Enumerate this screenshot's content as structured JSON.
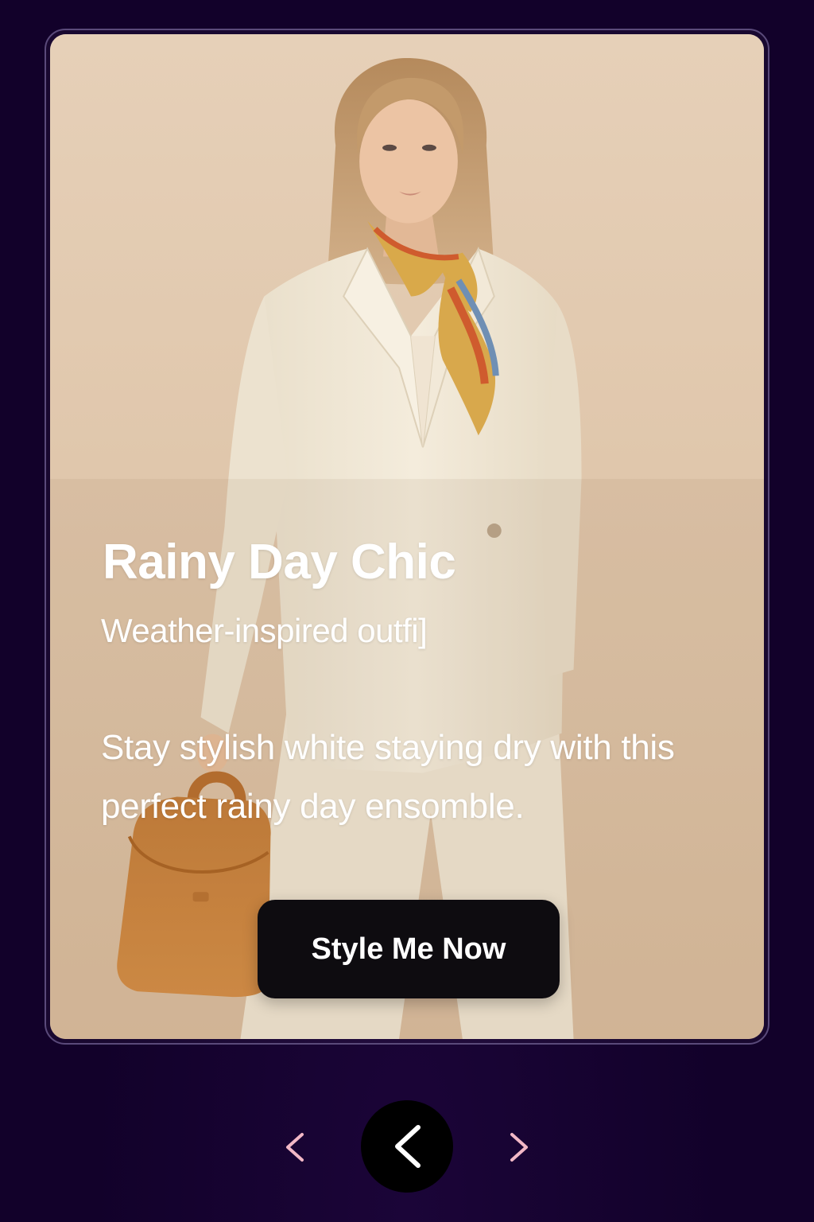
{
  "card": {
    "title": "Rainy Day Chic",
    "subtitle": "Weather-inspired outfi]",
    "description": "Stay stylish white staying dry with this perfect rainy day ensomble.",
    "cta_label": "Style Me Now",
    "image_icon": "fashion-model-photo"
  },
  "navigation": {
    "prev_icon": "chevron-left-icon",
    "main_icon": "chevron-left-icon",
    "next_icon": "chevron-right-icon"
  },
  "colors": {
    "background": "#12012a",
    "card_bg": "#e0c8ad",
    "cta_bg": "#0e0c10",
    "accent_chevron": "#f2b8c6"
  }
}
